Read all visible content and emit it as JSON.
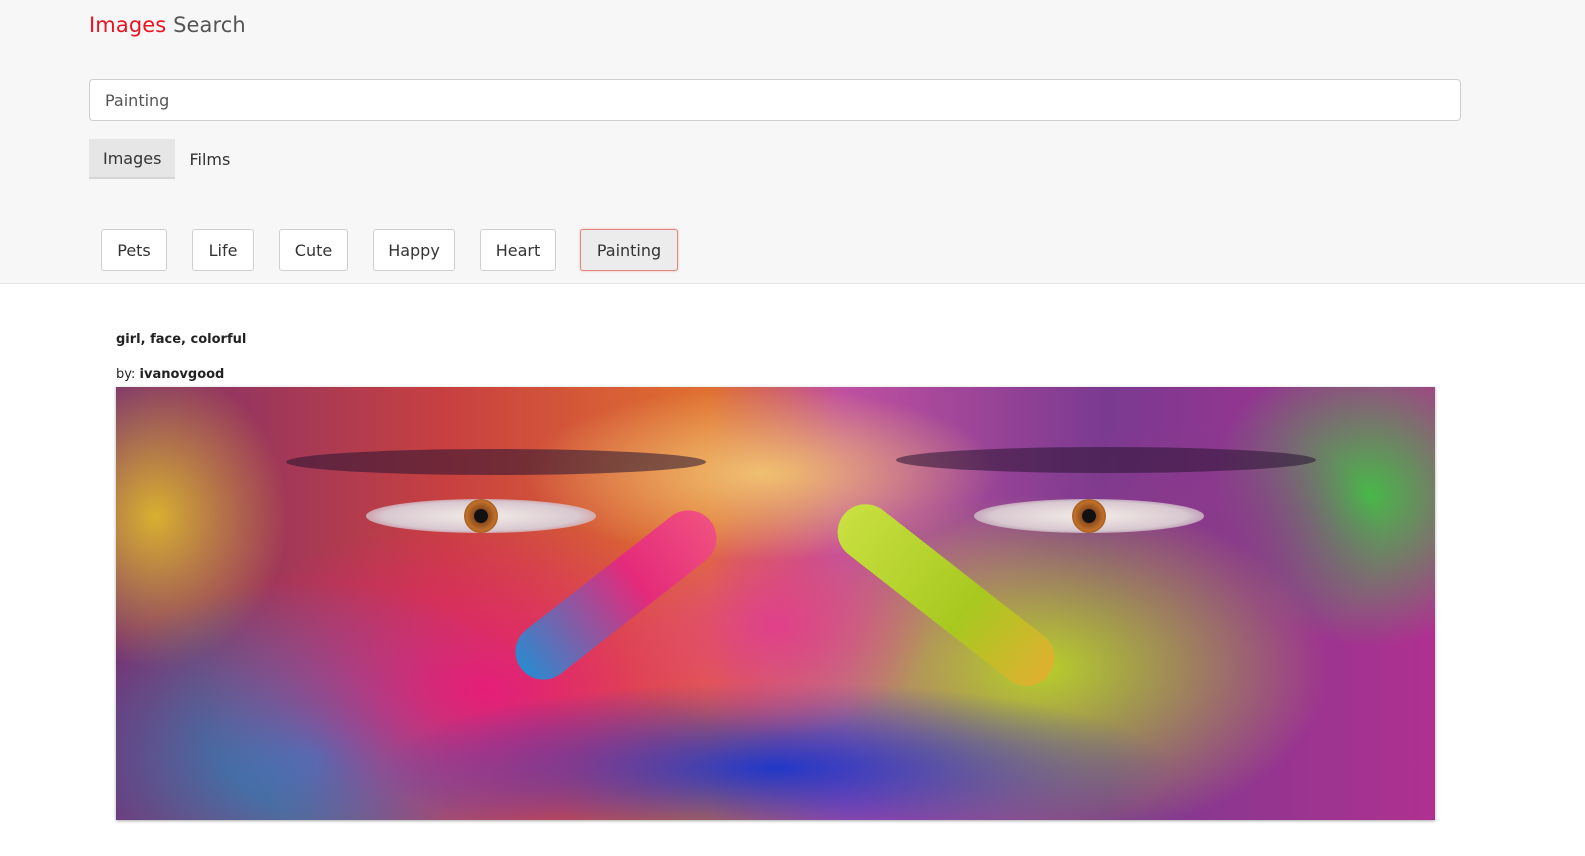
{
  "header": {
    "brand_primary": "Images",
    "brand_secondary": "Search",
    "brand_color": "#e8141f"
  },
  "search": {
    "value": "Painting",
    "placeholder": ""
  },
  "tabs": [
    {
      "label": "Images",
      "active": true
    },
    {
      "label": "Films",
      "active": false
    }
  ],
  "tags": [
    {
      "label": "Pets",
      "active": false
    },
    {
      "label": "Life",
      "active": false
    },
    {
      "label": "Cute",
      "active": false
    },
    {
      "label": "Happy",
      "active": false
    },
    {
      "label": "Heart",
      "active": false
    },
    {
      "label": "Painting",
      "active": true
    }
  ],
  "result": {
    "title": "girl, face, colorful",
    "by_label": "by:",
    "author": "ivanovgood"
  }
}
